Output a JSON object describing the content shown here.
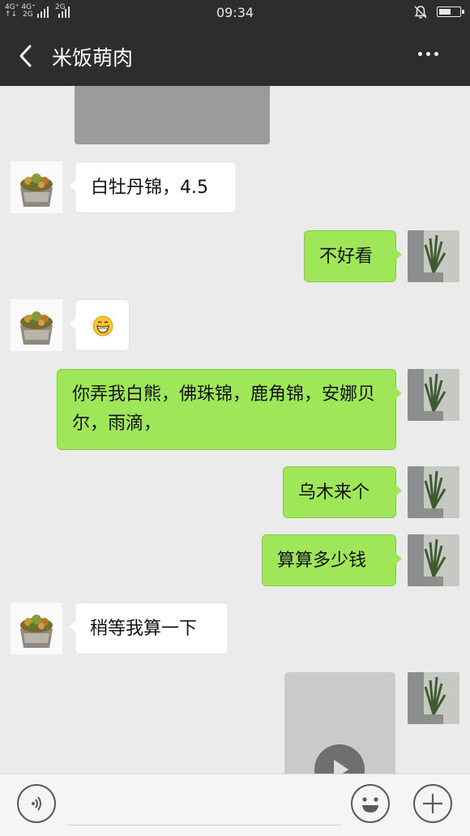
{
  "status_bar": {
    "network_labels": [
      "4G⁺",
      "4G⁺",
      "2G"
    ],
    "network_sub": [
      "↑↓",
      "2G",
      ""
    ],
    "time": "09:34",
    "icons": [
      "signal-icon",
      "bell-off-icon",
      "battery-icon"
    ]
  },
  "header": {
    "title": "米饭萌肉",
    "back_icon": "chevron-left-icon",
    "more_icon": "more-icon"
  },
  "messages": [
    {
      "side": "left",
      "type": "text",
      "text": "白牡丹锦，4.5"
    },
    {
      "side": "right",
      "type": "text",
      "text": "不好看"
    },
    {
      "side": "left",
      "type": "emoji",
      "text": "grinning-emoji"
    },
    {
      "side": "right",
      "type": "text",
      "text": "你弄我白熊，佛珠锦，鹿角锦，安娜贝尔，雨滴，"
    },
    {
      "side": "right",
      "type": "text",
      "text": "乌木来个"
    },
    {
      "side": "right",
      "type": "text",
      "text": "算算多少钱"
    },
    {
      "side": "left",
      "type": "text",
      "text": "稍等我算一下"
    },
    {
      "side": "right",
      "type": "video",
      "text": ""
    }
  ],
  "input_bar": {
    "voice_icon": "voice-icon",
    "emoji_icon": "emoji-icon",
    "add_icon": "plus-icon",
    "input_value": ""
  },
  "colors": {
    "header_bg": "#2d2d2d",
    "chat_bg": "#ebebeb",
    "outgoing_bubble": "#9fe658",
    "incoming_bubble": "#ffffff"
  }
}
